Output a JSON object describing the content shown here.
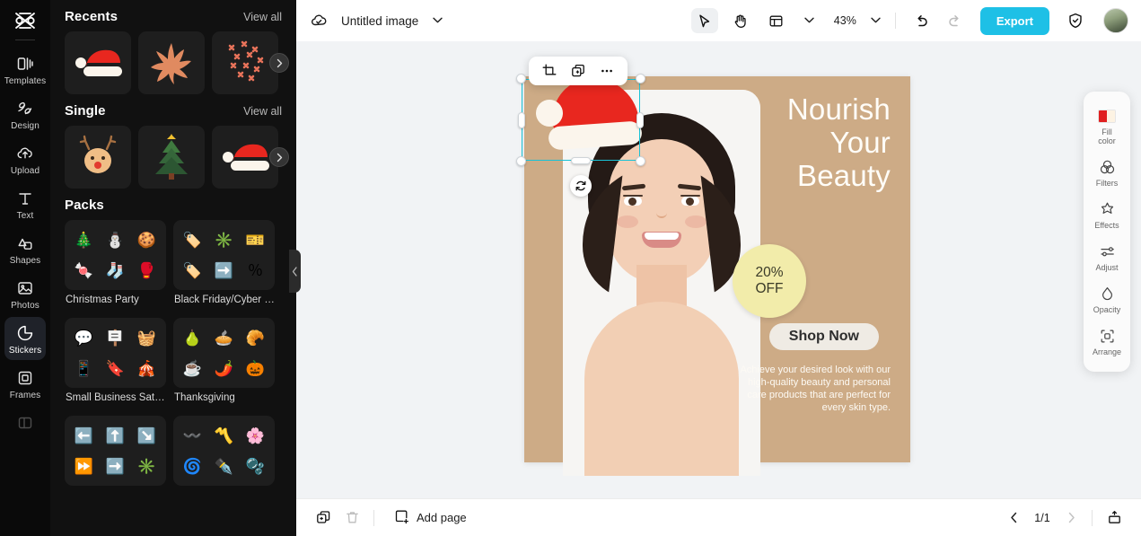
{
  "rail": {
    "logo_icon": "capcut-logo",
    "items": [
      {
        "label": "Templates",
        "icon": "templates-icon",
        "active": false
      },
      {
        "label": "Design",
        "icon": "design-icon",
        "active": false
      },
      {
        "label": "Upload",
        "icon": "upload-cloud-icon",
        "active": false
      },
      {
        "label": "Text",
        "icon": "text-t-icon",
        "active": false
      },
      {
        "label": "Shapes",
        "icon": "shapes-icon",
        "active": false
      },
      {
        "label": "Photos",
        "icon": "photos-icon",
        "active": false
      },
      {
        "label": "Stickers",
        "icon": "sticker-icon",
        "active": true
      },
      {
        "label": "Frames",
        "icon": "frames-icon",
        "active": false
      }
    ]
  },
  "panel": {
    "collapse_icon": "chevron-left-icon",
    "sections": [
      {
        "title": "Recents",
        "view_all": "View all",
        "thumbs": [
          "santa-hat-sticker",
          "maple-leaf-sticker",
          "red-x-confetti-sticker"
        ],
        "next_icon": "chevron-right-icon"
      },
      {
        "title": "Single",
        "view_all": "View all",
        "thumbs": [
          "reindeer-face-sticker",
          "christmas-tree-sticker",
          "santa-hat-sticker"
        ],
        "next_icon": "chevron-right-icon"
      }
    ],
    "packs_title": "Packs",
    "packs": [
      {
        "label": "Christmas Party",
        "glyphs": [
          "🎄",
          "⛄",
          "🍪",
          "🍬",
          "🧦",
          "🥊"
        ]
      },
      {
        "label": "Black Friday/Cyber M...",
        "glyphs": [
          "🏷️",
          "✳️",
          "🎫",
          "🏷️",
          "➡️",
          "％"
        ]
      },
      {
        "label": "Small Business Saturd...",
        "glyphs": [
          "💬",
          "🪧",
          "🧺",
          "📱",
          "🔖",
          "🎪"
        ]
      },
      {
        "label": "Thanksgiving",
        "glyphs": [
          "🍐",
          "🥧",
          "🥐",
          "☕",
          "🌶️",
          "🎃"
        ]
      },
      {
        "label": "",
        "glyphs": [
          "⬅️",
          "⬆️",
          "↘️",
          "⏩",
          "➡️",
          "✳️"
        ]
      },
      {
        "label": "",
        "glyphs": [
          "〰️",
          "〽️",
          "🌸",
          "🌀",
          "✒️",
          "🫧"
        ]
      }
    ]
  },
  "topbar": {
    "cloud_icon": "cloud-saved-icon",
    "doc_title": "Untitled image",
    "title_chevron_icon": "chevron-down-icon",
    "select_tool_icon": "cursor-arrow-icon",
    "hand_tool_icon": "hand-pan-icon",
    "layout_tool_icon": "layout-grid-icon",
    "layout_chevron_icon": "chevron-down-icon",
    "zoom_value": "43%",
    "zoom_chevron_icon": "chevron-down-icon",
    "undo_icon": "undo-arrow-icon",
    "redo_icon": "redo-arrow-icon",
    "export_label": "Export",
    "shield_icon": "shield-check-icon",
    "avatar_name": "user-avatar"
  },
  "context_toolbar": {
    "crop_icon": "crop-icon",
    "duplicate_icon": "duplicate-layer-icon",
    "more_icon": "more-horizontal-icon"
  },
  "selection": {
    "rotate_icon": "rotate-handle-icon",
    "object_name": "santa-hat-sticker",
    "accent_color": "#18c2d6"
  },
  "poster": {
    "background_color": "#cdab86",
    "headline_lines": [
      "Nourish",
      "Your",
      "Beauty"
    ],
    "badge_lines": [
      "20%",
      "OFF"
    ],
    "badge_color": "#f2ecaa",
    "cta_label": "Shop Now",
    "body_text": "Achieve your desired look with our high-quality beauty and personal care products that are perfect for every skin type.",
    "photo_alt": "woman-portrait-photo"
  },
  "right_panel": {
    "items": [
      {
        "label": "Fill\ncolor",
        "label_line1": "Fill",
        "label_line2": "color",
        "icon": "fill-color-swatch",
        "color_a": "#e02020",
        "color_b": "#fdf3e3"
      },
      {
        "label": "Filters",
        "icon": "filters-icon"
      },
      {
        "label": "Effects",
        "icon": "effects-star-icon"
      },
      {
        "label": "Adjust",
        "icon": "adjust-sliders-icon"
      },
      {
        "label": "Opacity",
        "icon": "opacity-droplet-icon"
      },
      {
        "label": "Arrange",
        "icon": "arrange-frame-icon"
      }
    ]
  },
  "bottombar": {
    "duplicate_page_icon": "duplicate-page-icon",
    "delete_page_icon": "trash-icon",
    "add_page_icon": "add-page-icon",
    "add_page_label": "Add page",
    "prev_icon": "chevron-left-icon",
    "page_indicator": "1/1",
    "next_icon": "chevron-right-icon",
    "export_image_icon": "export-box-icon"
  }
}
